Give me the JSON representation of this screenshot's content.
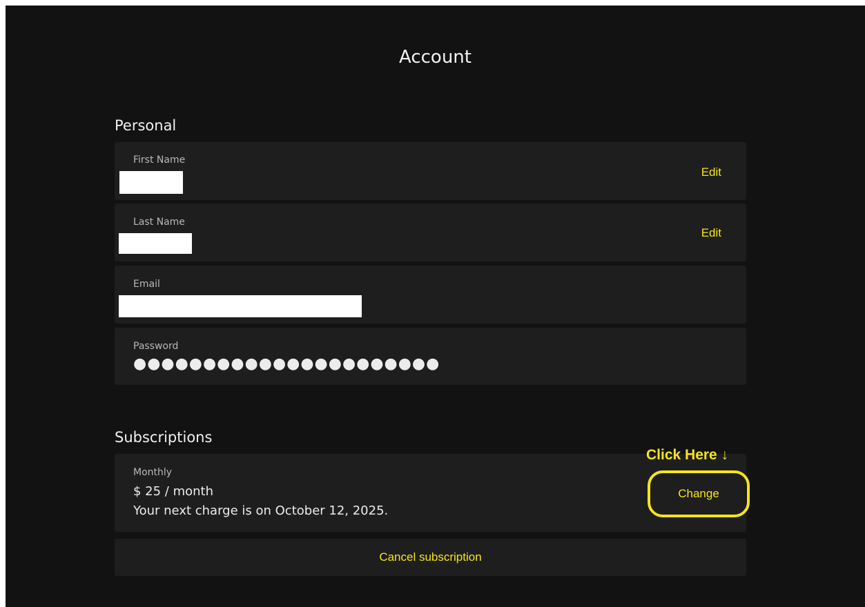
{
  "page": {
    "title": "Account"
  },
  "personal": {
    "heading": "Personal",
    "first_name": {
      "label": "First Name",
      "action": "Edit"
    },
    "last_name": {
      "label": "Last Name",
      "action": "Edit"
    },
    "email": {
      "label": "Email"
    },
    "password": {
      "label": "Password",
      "masked": "●●●●●●●●●●●●●●●●●●●●●●"
    }
  },
  "subscriptions": {
    "heading": "Subscriptions",
    "plan_name": "Monthly",
    "price": "$ 25 / month",
    "next_charge": "Your next charge is on October 12, 2025.",
    "change_label": "Change",
    "cancel_label": "Cancel subscription"
  },
  "annotation": {
    "text": "Click Here ↓",
    "color": "#f5e51c"
  },
  "colors": {
    "accent": "#f5e51c",
    "background": "#121212",
    "card": "#1e1e1e"
  }
}
